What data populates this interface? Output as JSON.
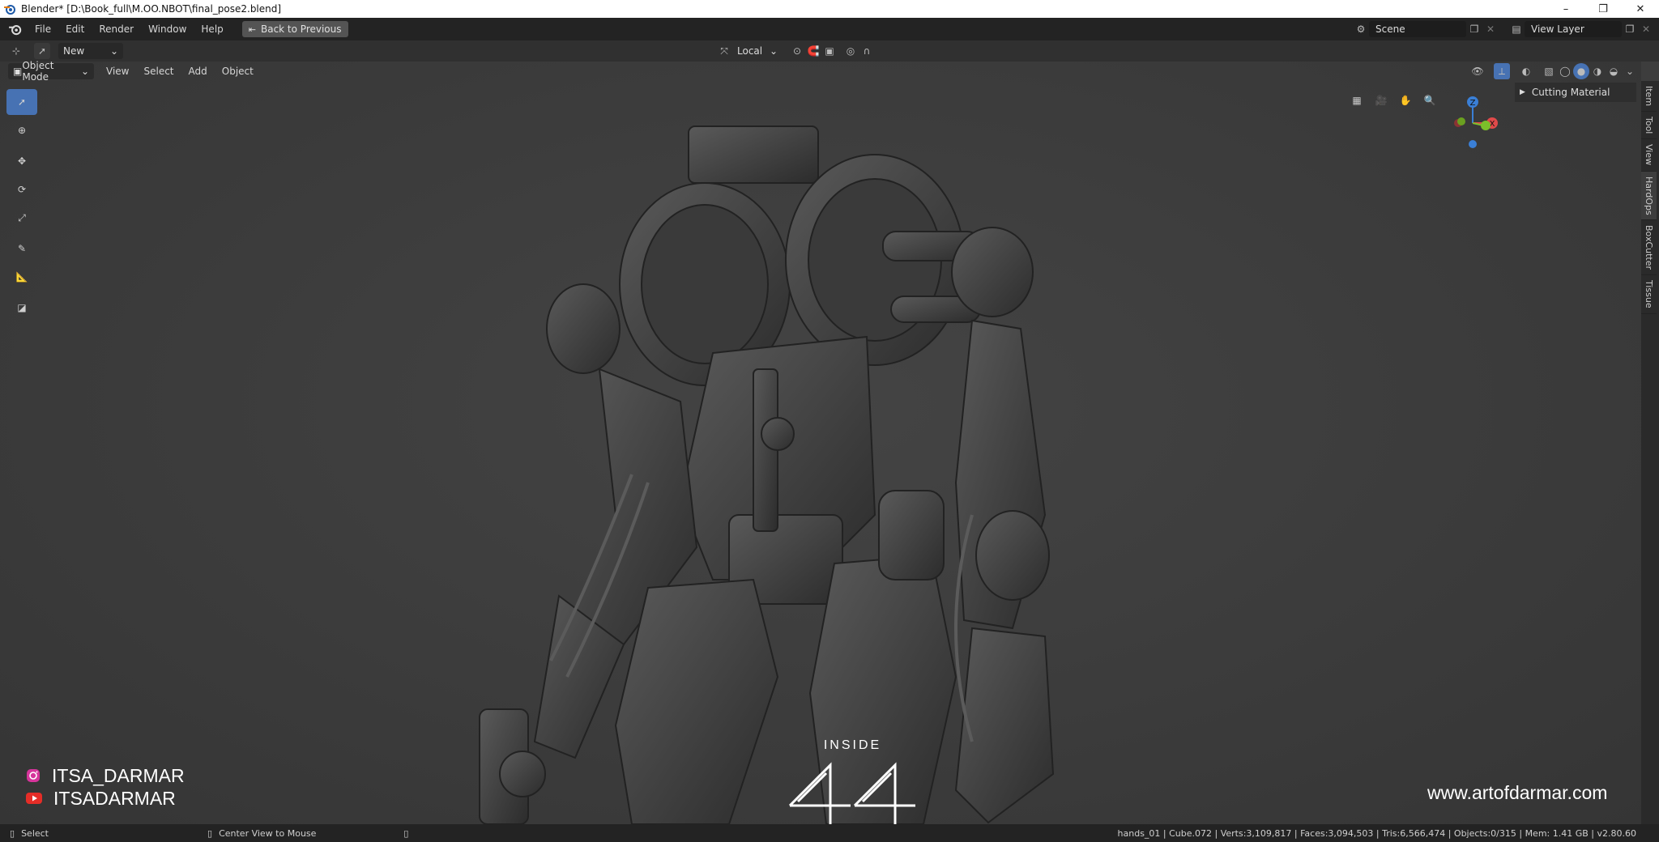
{
  "window": {
    "title": "Blender* [D:\\Book_full\\M.OO.NBOT\\final_pose2.blend]",
    "minimize": "–",
    "maximize": "❐",
    "close": "✕"
  },
  "topbar": {
    "menus": [
      "File",
      "Edit",
      "Render",
      "Window",
      "Help"
    ],
    "back_button": "Back to Previous",
    "scene_label": "Scene",
    "view_layer_label": "View Layer"
  },
  "tool_header": {
    "new_dropdown": "New",
    "transform_orientation": "Local"
  },
  "viewport_header": {
    "mode": "Object Mode",
    "menus": [
      "View",
      "Select",
      "Add",
      "Object"
    ]
  },
  "npanel": {
    "section": "Cutting Material",
    "tabs": [
      "Item",
      "Tool",
      "View",
      "HardOps",
      "BoxCutter",
      "Tissue"
    ]
  },
  "gizmo": {
    "x": "X",
    "z": "Z"
  },
  "overlay": {
    "instagram": "ITSA_DARMAR",
    "youtube": "ITSADARMAR",
    "brand_top": "INSIDE",
    "website": "www.artofdarmar.com"
  },
  "statusbar": {
    "left_action": "Select",
    "middle_action": "Center View to Mouse",
    "stats": "hands_01 | Cube.072 | Verts:3,109,817 | Faces:3,094,503 | Tris:6,566,474 | Objects:0/315 | Mem: 1.41 GB | v2.80.60"
  },
  "colors": {
    "accent": "#4772b3",
    "axis_x": "#e04a4a",
    "axis_y": "#7bbf2a",
    "axis_z": "#3a7fd6"
  }
}
